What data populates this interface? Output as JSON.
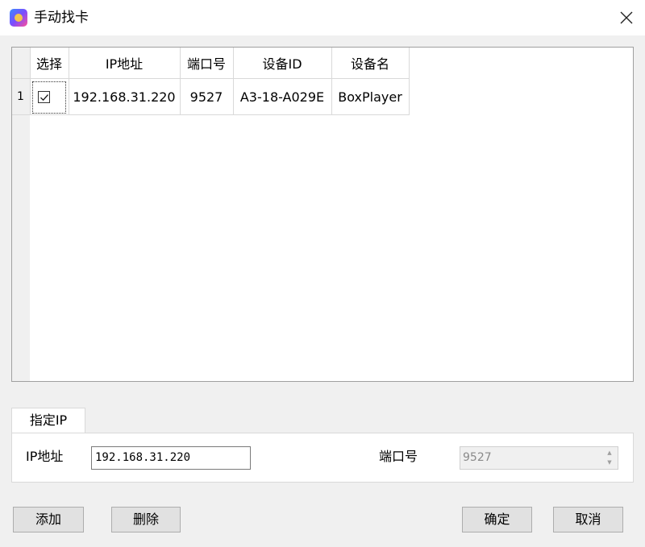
{
  "window": {
    "title": "手动找卡",
    "icon": "app-logo-icon",
    "close_icon": "close-icon"
  },
  "table": {
    "columns": [
      "选择",
      "IP地址",
      "端口号",
      "设备ID",
      "设备名"
    ],
    "rows": [
      {
        "row_number": "1",
        "selected": true,
        "ip": "192.168.31.220",
        "port": "9527",
        "device_id": "A3-18-A029E",
        "device_name": "BoxPlayer"
      }
    ]
  },
  "specify_ip": {
    "tab_label": "指定IP",
    "ip_label": "IP地址",
    "ip_value": "192.168.31.220",
    "port_label": "端口号",
    "port_value": "9527"
  },
  "buttons": {
    "add": "添加",
    "delete": "删除",
    "ok": "确定",
    "cancel": "取消"
  }
}
